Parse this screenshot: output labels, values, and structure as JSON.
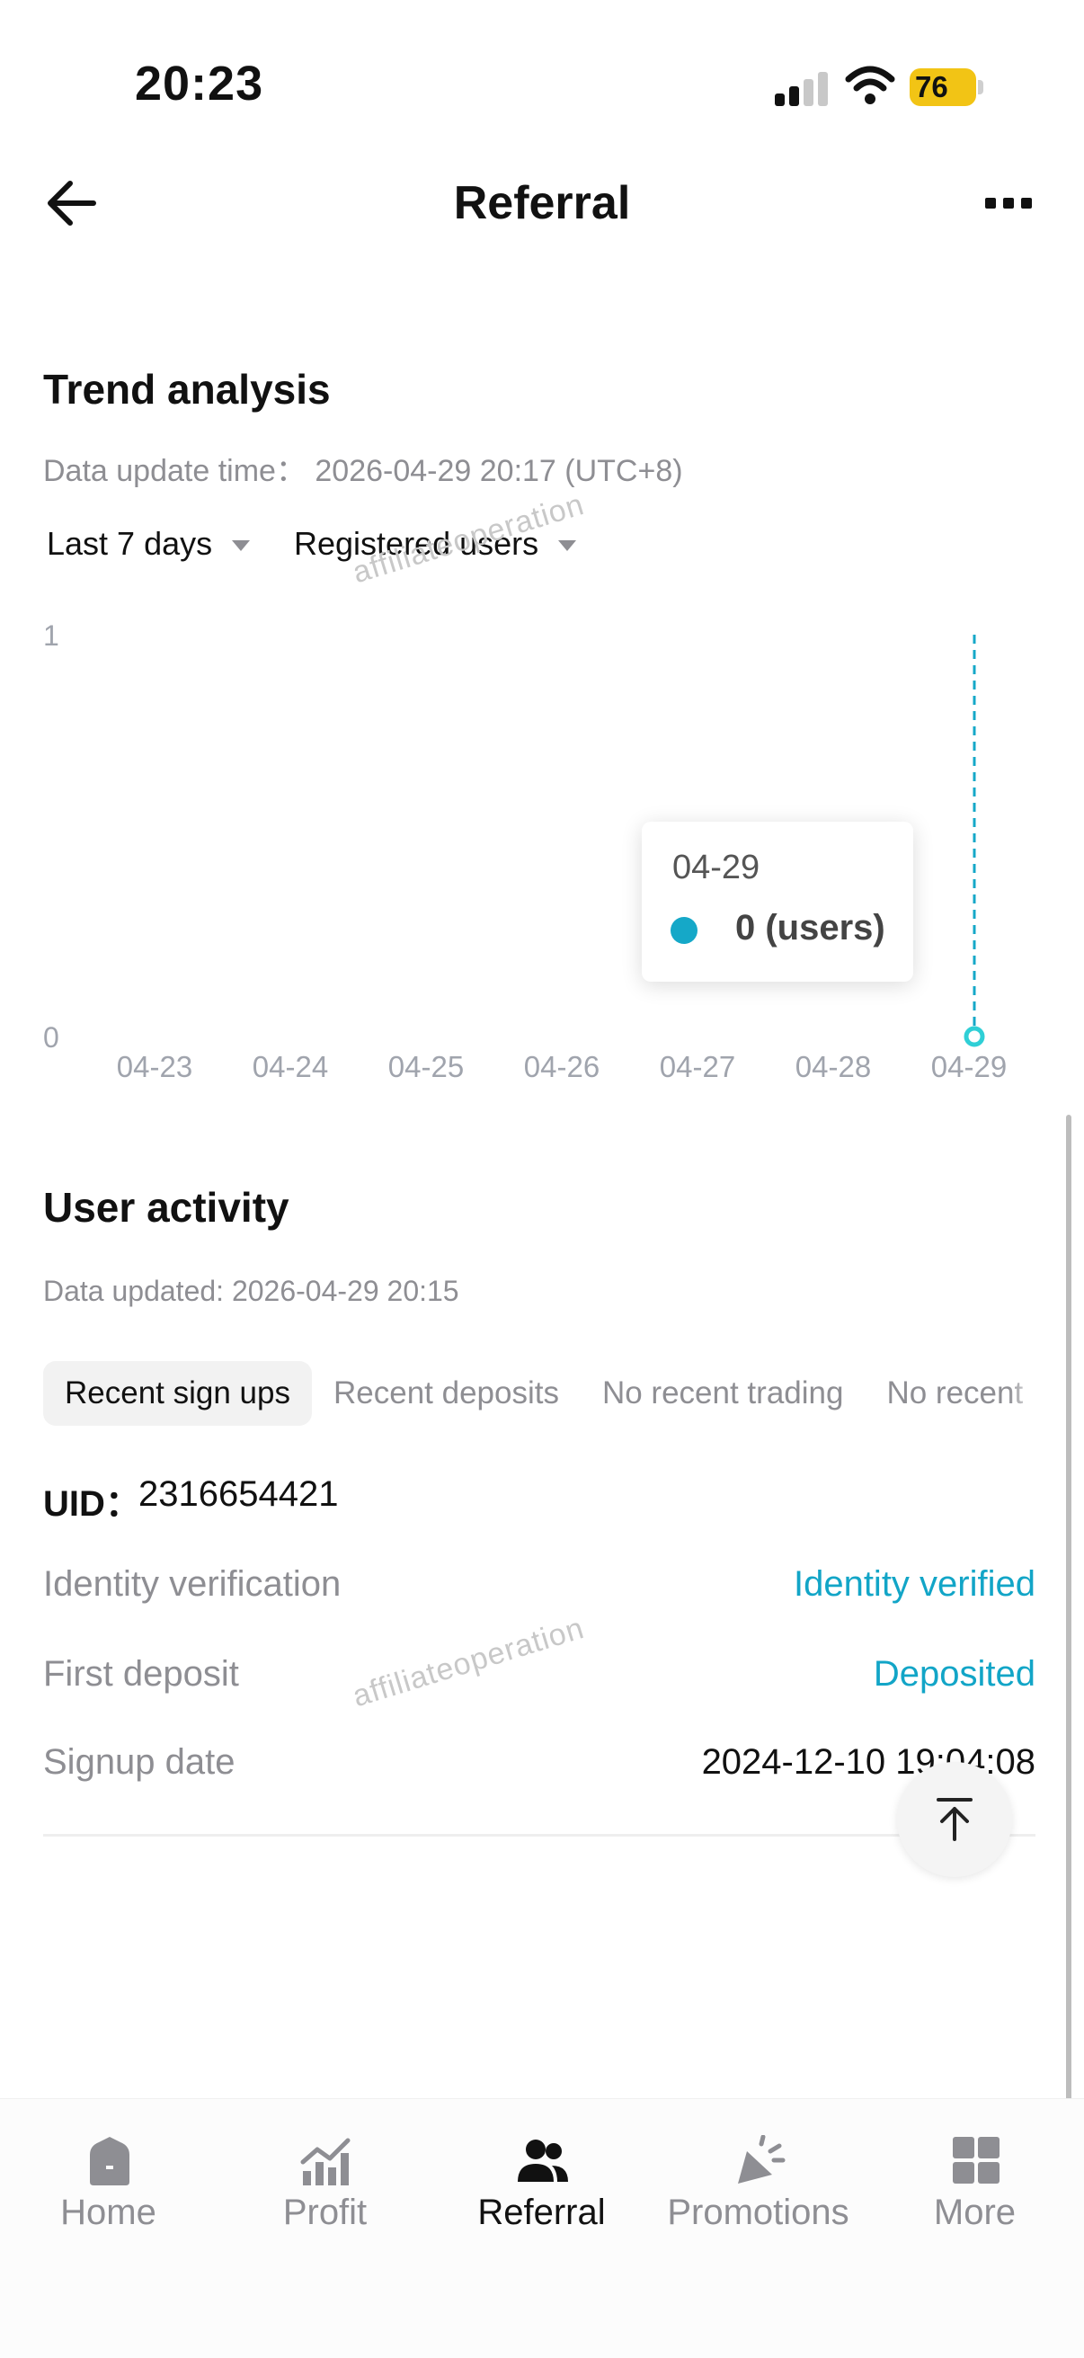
{
  "status_bar": {
    "time": "20:23",
    "battery": "76"
  },
  "header": {
    "title": "Referral"
  },
  "trend": {
    "title": "Trend analysis",
    "update_time": "Data update time： 2026-04-29 20:17 (UTC+8)",
    "period_filter": "Last 7 days",
    "metric_filter": "Registered users",
    "watermark": "affiliateoperation",
    "tooltip": {
      "date": "04-29",
      "value": "0 (users)"
    }
  },
  "chart_data": {
    "type": "line",
    "x": [
      "04-23",
      "04-24",
      "04-25",
      "04-26",
      "04-27",
      "04-28",
      "04-29"
    ],
    "y_ticks": [
      "0",
      "1"
    ],
    "ylim": [
      0,
      1
    ],
    "series": [
      {
        "values": [
          0,
          0,
          0,
          0,
          0,
          0,
          0
        ]
      }
    ],
    "highlight_index": 6,
    "series_color": "#15a8c8"
  },
  "activity": {
    "title": "User activity",
    "updated": "Data updated: 2026-04-29 20:15",
    "tabs": [
      "Recent sign ups",
      "Recent deposits",
      "No recent trading",
      "No recent"
    ],
    "uid_label": "UID：",
    "uid_value": "2316654421",
    "rows": [
      {
        "label": "Identity verification",
        "value": "Identity verified"
      },
      {
        "label": "First deposit",
        "value": "Deposited"
      },
      {
        "label": "Signup date",
        "value": "2024-12-10 19:04:08"
      }
    ],
    "watermark": "affiliateoperation"
  },
  "colors": {
    "accent": "#12a5c7",
    "muted": "#8e8e93"
  },
  "nav": {
    "items": [
      {
        "label": "Home",
        "icon": "home-icon"
      },
      {
        "label": "Profit",
        "icon": "chart-icon"
      },
      {
        "label": "Referral",
        "icon": "users-icon"
      },
      {
        "label": "Promotions",
        "icon": "megaphone-icon"
      },
      {
        "label": "More",
        "icon": "grid-icon"
      }
    ]
  }
}
